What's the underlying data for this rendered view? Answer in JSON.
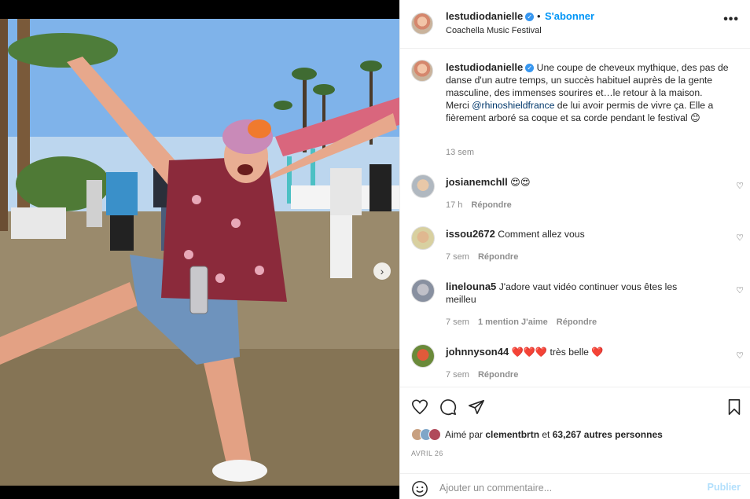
{
  "post": {
    "author": "lestudiodanielle",
    "follow_label": "S'abonner",
    "separator": "•",
    "location": "Coachella Music Festival",
    "more_label": "•••",
    "carousel_next": "›"
  },
  "caption": {
    "author": "lestudiodanielle",
    "text_1": "Une coupe de cheveux mythique, des pas de danse d'un autre temps, un succès habituel auprès de la gente masculine, des immenses sourires et…le retour à la maison.",
    "text_2_prefix": "Merci ",
    "mention": "@rhinoshieldfrance",
    "text_2_suffix": " de lui avoir permis de vivre ça. Elle a fièrement arboré sa coque et sa corde pendant le festival 😊",
    "time": "13 sem"
  },
  "comments": [
    {
      "user": "josianemchll",
      "text": "😍😍",
      "time": "17 h",
      "likes": "",
      "reply": "Répondre"
    },
    {
      "user": "issou2672",
      "text": "Comment allez vous",
      "time": "7 sem",
      "likes": "",
      "reply": "Répondre"
    },
    {
      "user": "linelouna5",
      "text": "J'adore vaut vidéo continuer vous êtes les meilleu",
      "time": "7 sem",
      "likes": "1 mention J'aime",
      "reply": "Répondre"
    },
    {
      "user": "johnnyson44",
      "text": "❤️❤️❤️ très belle ❤️",
      "time": "7 sem",
      "likes": "",
      "reply": "Répondre"
    }
  ],
  "likes": {
    "prefix": "Aimé par ",
    "user": "clementbrtn",
    "middle": " et ",
    "others": "63,267 autres personnes"
  },
  "date": "AVRIL 26",
  "composer": {
    "placeholder": "Ajouter un commentaire...",
    "publish_label": "Publier"
  },
  "colors": {
    "accent": "#0095f6",
    "publish_disabled": "#b2dffc",
    "secondary_text": "#8e8e8e",
    "mention": "#00376b"
  },
  "icons": [
    "verified-badge-icon",
    "more-options-icon",
    "heart-icon",
    "comment-icon",
    "share-icon",
    "bookmark-icon",
    "emoji-icon",
    "chevron-right-icon"
  ]
}
